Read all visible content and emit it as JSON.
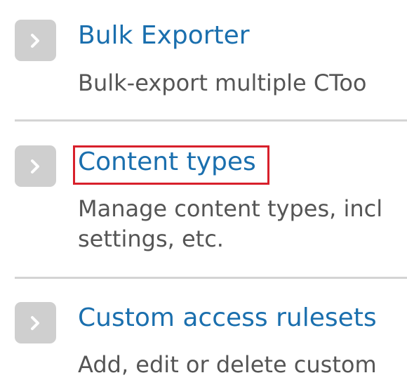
{
  "items": [
    {
      "title": "Bulk Exporter",
      "description_lines": [
        "Bulk-export multiple CToo"
      ]
    },
    {
      "title": "Content types",
      "description_lines": [
        "Manage content types, incl",
        "settings, etc."
      ]
    },
    {
      "title": "Custom access rulesets",
      "description_lines": [
        "Add, edit or delete custom"
      ]
    }
  ],
  "colors": {
    "link": "#1a6fae",
    "description": "#555555",
    "arrow_button": "#cfcfcf",
    "highlight": "#d8202b",
    "divider": "#d4d4d4"
  },
  "icons": {
    "expand": "chevron-right-icon"
  }
}
